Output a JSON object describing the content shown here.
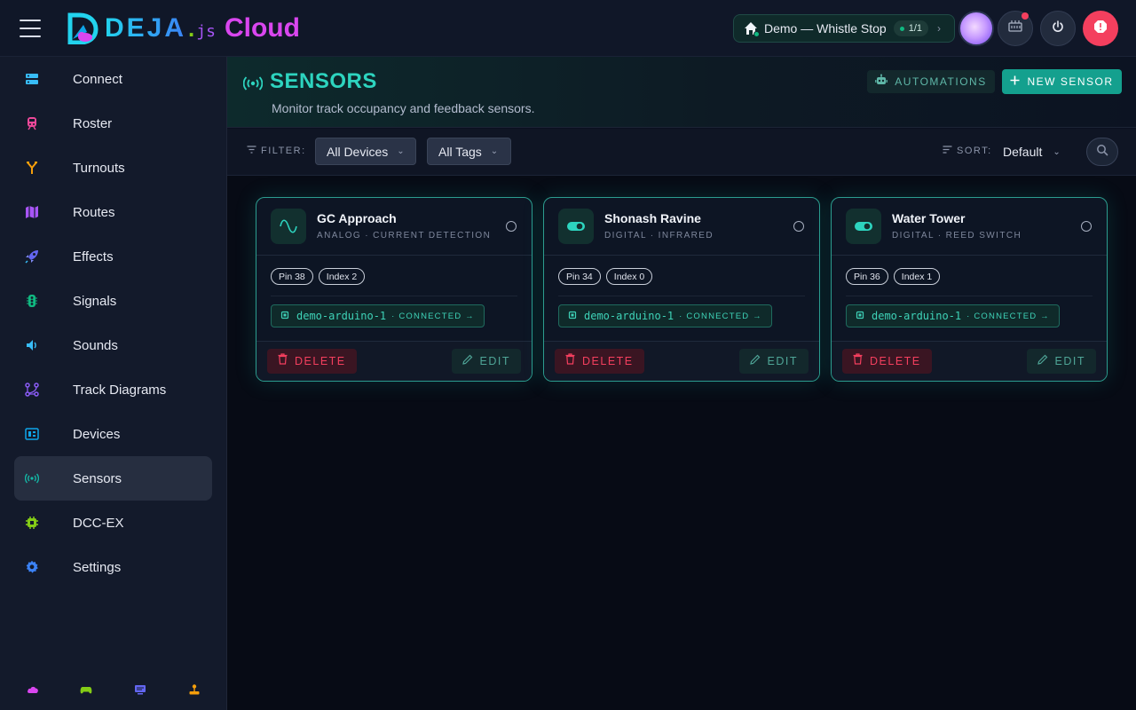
{
  "app": {
    "logo_main": "DEJA",
    "logo_dot": ".",
    "logo_js": "js",
    "logo_cloud": "Cloud"
  },
  "topbar": {
    "layout_label": "Demo — Whistle Stop",
    "layout_count": "1/1",
    "icons": [
      "menu-icon",
      "home-icon",
      "chevron-right-icon",
      "command-station-icon",
      "power-icon",
      "emergency-stop-icon"
    ],
    "colors": {
      "accent": "#14b8a6",
      "danger": "#f43f5e"
    }
  },
  "sidebar": {
    "items": [
      {
        "label": "Connect",
        "icon": "connect-icon",
        "color": "#38bdf8"
      },
      {
        "label": "Roster",
        "icon": "train-icon",
        "color": "#ec4899"
      },
      {
        "label": "Turnouts",
        "icon": "turnout-icon",
        "color": "#f59e0b"
      },
      {
        "label": "Routes",
        "icon": "map-icon",
        "color": "#a855f7"
      },
      {
        "label": "Effects",
        "icon": "rocket-icon",
        "color": "#6366f1"
      },
      {
        "label": "Signals",
        "icon": "signal-icon",
        "color": "#10b981"
      },
      {
        "label": "Sounds",
        "icon": "speaker-icon",
        "color": "#38bdf8"
      },
      {
        "label": "Track Diagrams",
        "icon": "diagram-icon",
        "color": "#8b5cf6"
      },
      {
        "label": "Devices",
        "icon": "device-icon",
        "color": "#0ea5e9"
      },
      {
        "label": "Sensors",
        "icon": "sensor-icon",
        "color": "#14b8a6",
        "active": true
      },
      {
        "label": "DCC-EX",
        "icon": "dccex-icon",
        "color": "#84cc16"
      },
      {
        "label": "Settings",
        "icon": "gear-icon",
        "color": "#3b82f6"
      }
    ],
    "footer_icons": [
      "cloud-icon",
      "gamepad-icon",
      "monitor-icon",
      "joystick-icon"
    ]
  },
  "page": {
    "title": "SENSORS",
    "subtitle": "Monitor track occupancy and feedback sensors.",
    "automations_label": "AUTOMATIONS",
    "new_sensor_label": "NEW SENSOR"
  },
  "filters": {
    "filter_label": "FILTER:",
    "device_select": "All Devices",
    "tags_select": "All Tags",
    "sort_label": "SORT:",
    "sort_select": "Default"
  },
  "sensors": [
    {
      "name": "GC Approach",
      "type": "ANALOG · CURRENT DETECTION",
      "icon": "analog-wave-icon",
      "pin": "Pin 38",
      "index": "Index 2",
      "device": "demo-arduino-1",
      "device_status": "· CONNECTED →",
      "delete_label": "DELETE",
      "edit_label": "EDIT"
    },
    {
      "name": "Shonash Ravine",
      "type": "DIGITAL · INFRARED",
      "icon": "toggle-icon",
      "pin": "Pin 34",
      "index": "Index 0",
      "device": "demo-arduino-1",
      "device_status": "· CONNECTED →",
      "delete_label": "DELETE",
      "edit_label": "EDIT"
    },
    {
      "name": "Water Tower",
      "type": "DIGITAL · REED SWITCH",
      "icon": "toggle-icon",
      "pin": "Pin 36",
      "index": "Index 1",
      "device": "demo-arduino-1",
      "device_status": "· CONNECTED →",
      "delete_label": "DELETE",
      "edit_label": "EDIT"
    }
  ]
}
